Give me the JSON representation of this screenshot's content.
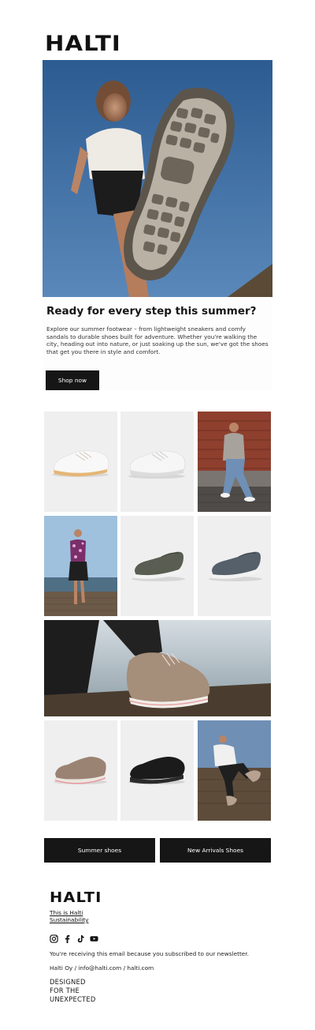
{
  "brand": {
    "logo_text": "HALTI"
  },
  "hero": {
    "image": "hero-shoe-sole-sky"
  },
  "intro": {
    "heading": "Ready for every step this summer?",
    "body": "Explore our summer footwear – from lightweight sneakers and comfy sandals to durable shoes built for adventure. Whether you're walking the city, heading out into nature, or just soaking up the sun, we've got the shoes that get you there in style and comfort.",
    "button_label": "Shop now"
  },
  "grid": {
    "tiles": [
      {
        "image": "white-sneaker-beige-sole"
      },
      {
        "image": "white-sneaker-grey-sole"
      },
      {
        "image": "man-sitting-brick-wall"
      },
      {
        "image": "woman-on-pier"
      },
      {
        "image": "olive-slip-on"
      },
      {
        "image": "grey-slip-on"
      },
      {
        "image": "beige-shoe-on-dock-lifestyle"
      },
      {
        "image": "beige-pink-trail-shoe"
      },
      {
        "image": "black-trail-shoe"
      },
      {
        "image": "man-on-bench-shoes"
      }
    ]
  },
  "ctas": {
    "left_label": "Summer shoes",
    "right_label": "New Arrivals Shoes"
  },
  "footer": {
    "logo_text": "HALTI",
    "links": [
      "This is Halti",
      "Sustainability"
    ],
    "socials": [
      "instagram-icon",
      "facebook-icon",
      "tiktok-icon",
      "youtube-icon"
    ],
    "notice": "You're receiving this email because you subscribed to our newsletter.",
    "contact": "Halti Oy / info@halti.com / halti.com",
    "tagline": [
      "DESIGNED",
      "FOR THE",
      "UNEXPECTED"
    ]
  }
}
